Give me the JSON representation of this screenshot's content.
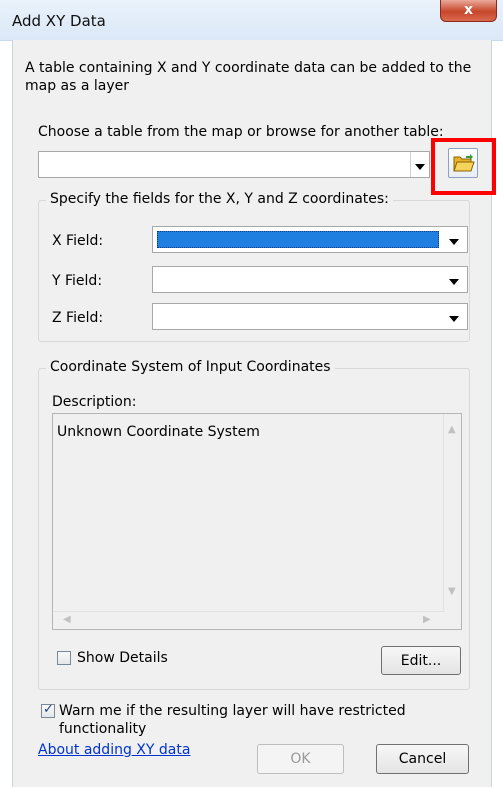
{
  "window": {
    "title": "Add XY Data",
    "close_label": "x"
  },
  "intro_text": "A table containing X and Y coordinate data can be added to the map as a layer",
  "table_prompt": "Choose a table from the map or browse for another table:",
  "table_combo": {
    "value": ""
  },
  "fields_group": {
    "label": "Specify the fields for the X, Y and Z coordinates:",
    "fields": [
      {
        "label": "X Field:",
        "value": "",
        "selected": true
      },
      {
        "label": "Y Field:",
        "value": ""
      },
      {
        "label": "Z Field:",
        "value": ""
      }
    ]
  },
  "coord_group": {
    "label": "Coordinate System of Input Coordinates",
    "description_label": "Description:",
    "description_text": "Unknown Coordinate System",
    "show_details_label": "Show Details",
    "show_details_checked": false,
    "edit_label": "Edit..."
  },
  "warn": {
    "label": "Warn me if the resulting layer will have restricted functionality",
    "checked": true
  },
  "footer": {
    "link_label": "About adding XY data",
    "ok_label": "OK",
    "cancel_label": "Cancel"
  },
  "colors": {
    "selection_blue": "#1e7fe0",
    "highlight_red": "#ff0000",
    "link_blue": "#0033cc"
  },
  "icons": {
    "browse": "folder-open-icon"
  }
}
